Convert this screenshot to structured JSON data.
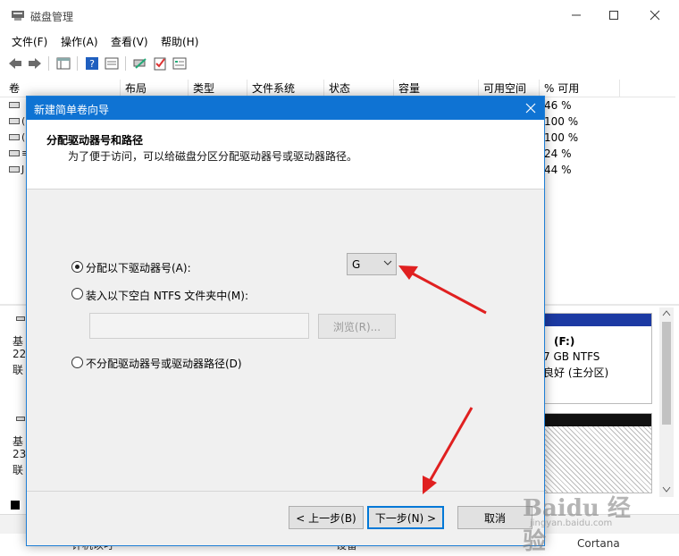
{
  "window": {
    "title": "磁盘管理"
  },
  "menu": [
    "文件(F)",
    "操作(A)",
    "查看(V)",
    "帮助(H)"
  ],
  "columns": [
    "卷",
    "布局",
    "类型",
    "文件系统",
    "状态",
    "容量",
    "可用空间",
    "% 可用"
  ],
  "volume_rows": [
    {
      "pct": "46 %"
    },
    {
      "frag": "(",
      "pct": "100 %"
    },
    {
      "frag": "(",
      "pct": "100 %"
    },
    {
      "frag": "≡",
      "pct": "24 %"
    },
    {
      "frag": "J",
      "pct": "44 %"
    }
  ],
  "disk_panel_f": {
    "drive": "(F:)",
    "size": "7 GB NTFS",
    "status": "良好 (主分区)"
  },
  "left_fragments": {
    "disk1": [
      "基",
      "22",
      "联"
    ],
    "disk2": [
      "基",
      "23",
      "联"
    ]
  },
  "bottom_fragments": {
    "left": "计机以叮",
    "mid": "设备",
    "right": "Cortana"
  },
  "dialog": {
    "title": "新建简单卷向导",
    "heading": "分配驱动器号和路径",
    "description": "为了便于访问，可以给磁盘分区分配驱动器号或驱动器路径。",
    "option_assign": "分配以下驱动器号(A):",
    "drive_letter": "G",
    "option_mount": "装入以下空白 NTFS 文件夹中(M):",
    "browse": "浏览(R)...",
    "option_none": "不分配驱动器号或驱动器路径(D)",
    "back": "< 上一步(B)",
    "next": "下一步(N) >",
    "cancel": "取消"
  },
  "watermark": {
    "text": "Baidu 经验",
    "sub": "jingyan.baidu.com"
  },
  "colors": {
    "dialog_title": "#0f73d3",
    "arrow": "#e02020",
    "disk_header": "#1c3aa3"
  }
}
